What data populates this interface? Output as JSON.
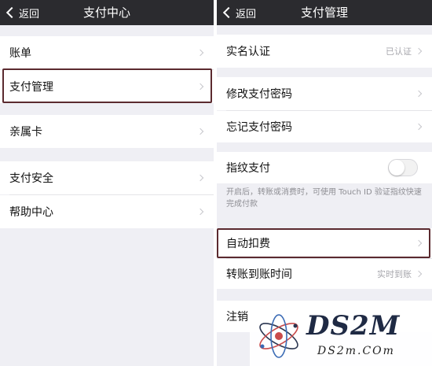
{
  "left_screen": {
    "back_label": "返回",
    "title": "支付中心",
    "items": [
      {
        "label": "账单"
      },
      {
        "label": "支付管理"
      },
      {
        "label": "亲属卡"
      },
      {
        "label": "支付安全"
      },
      {
        "label": "帮助中心"
      }
    ]
  },
  "right_screen": {
    "back_label": "返回",
    "title": "支付管理",
    "real_name": {
      "label": "实名认证",
      "value": "已认证"
    },
    "change_password": {
      "label": "修改支付密码"
    },
    "forgot_password": {
      "label": "忘记支付密码"
    },
    "fingerprint": {
      "label": "指纹支付",
      "enabled": false,
      "hint": "开启后，转账或消费时，可使用 Touch ID 验证指纹快速完成付款"
    },
    "auto_deduct": {
      "label": "自动扣费"
    },
    "transfer_time": {
      "label": "转账到账时间",
      "value": "实时到账"
    },
    "cancel_service": {
      "label": "注销"
    }
  },
  "watermark": {
    "big": "DS2M",
    "small": "DS2m.COm"
  },
  "colors": {
    "navbar": "#2b2b2f",
    "background": "#efeff4",
    "highlight": "#5b2a2f"
  }
}
